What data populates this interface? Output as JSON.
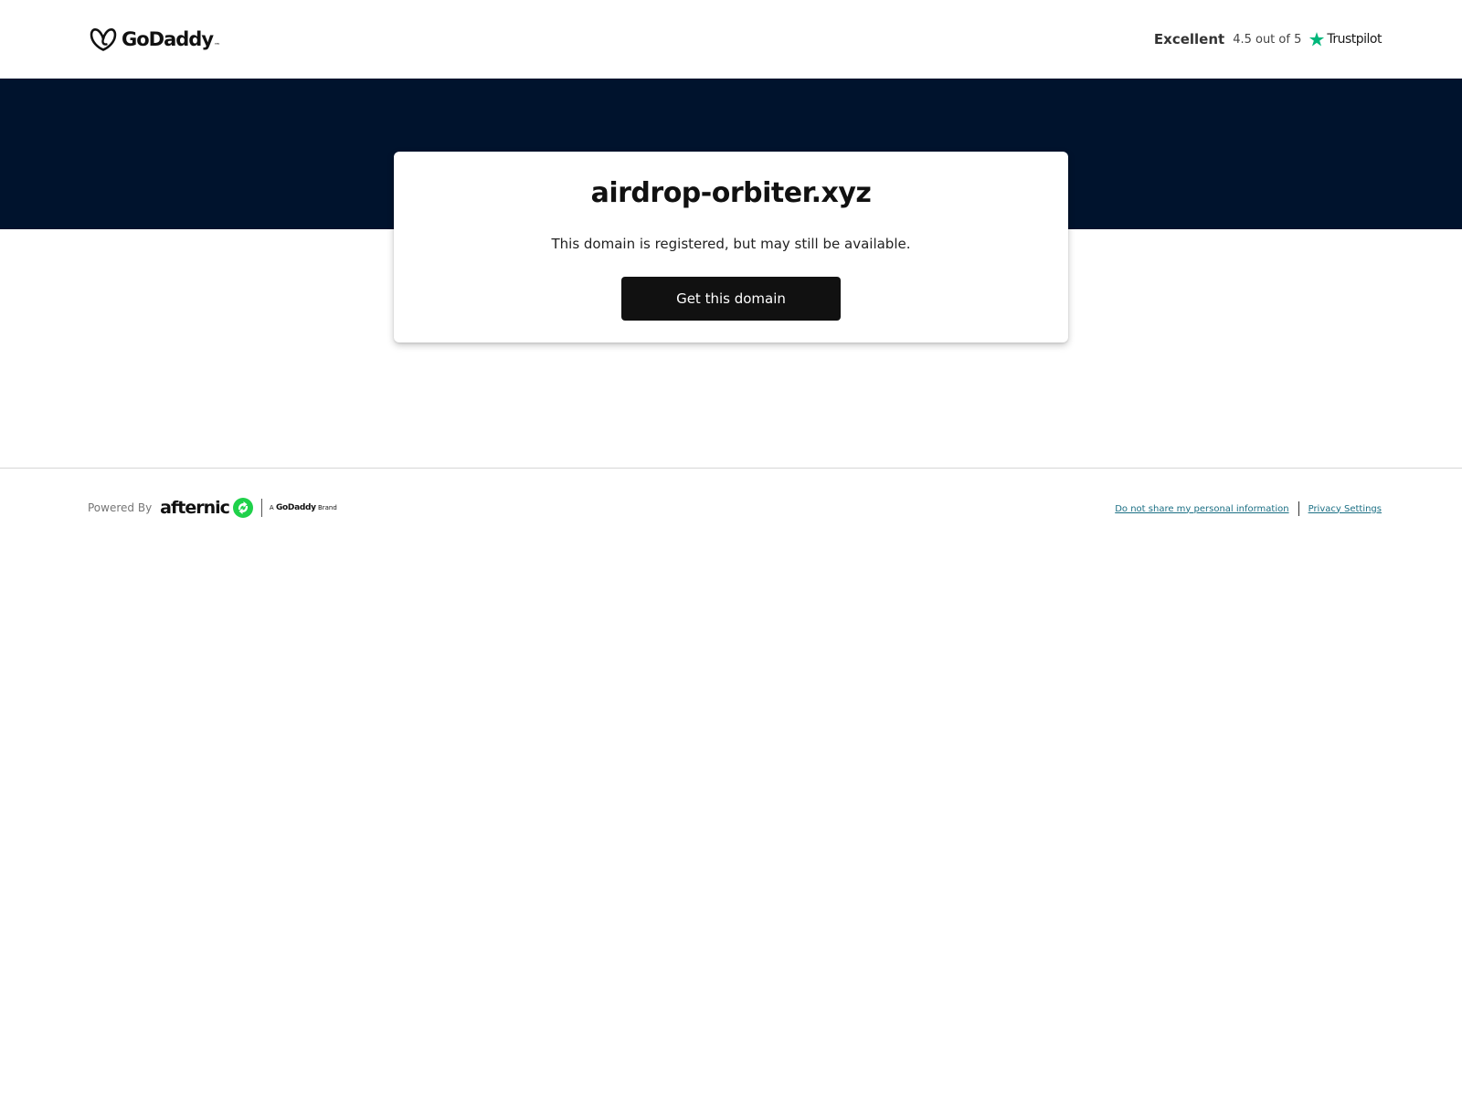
{
  "header": {
    "logo_text": "GoDaddy",
    "logo_tm": "™",
    "logo_icon": "godaddy-heart-icon",
    "rating": {
      "word": "Excellent",
      "score": "4.5 out of 5",
      "star_icon": "trustpilot-star-icon",
      "provider": "Trustpilot",
      "star_color": "#00b67a"
    }
  },
  "colors": {
    "hero_bg": "#00132d",
    "button_bg": "#111111",
    "link": "#1b6f84",
    "afternic_green": "#1fd14a"
  },
  "card": {
    "domain": "airdrop-orbiter.xyz",
    "subtitle": "This domain is registered, but may still be available.",
    "cta_label": "Get this domain"
  },
  "footer": {
    "powered_by": "Powered By",
    "brand_name": "afternic",
    "brand_icon": "afternic-arrows-icon",
    "brand_tag_prefix": "A",
    "brand_tag_name": "GoDaddy",
    "brand_tag_suffix": "Brand",
    "links": {
      "do_not_share": "Do not share my personal information",
      "privacy": "Privacy Settings"
    }
  }
}
